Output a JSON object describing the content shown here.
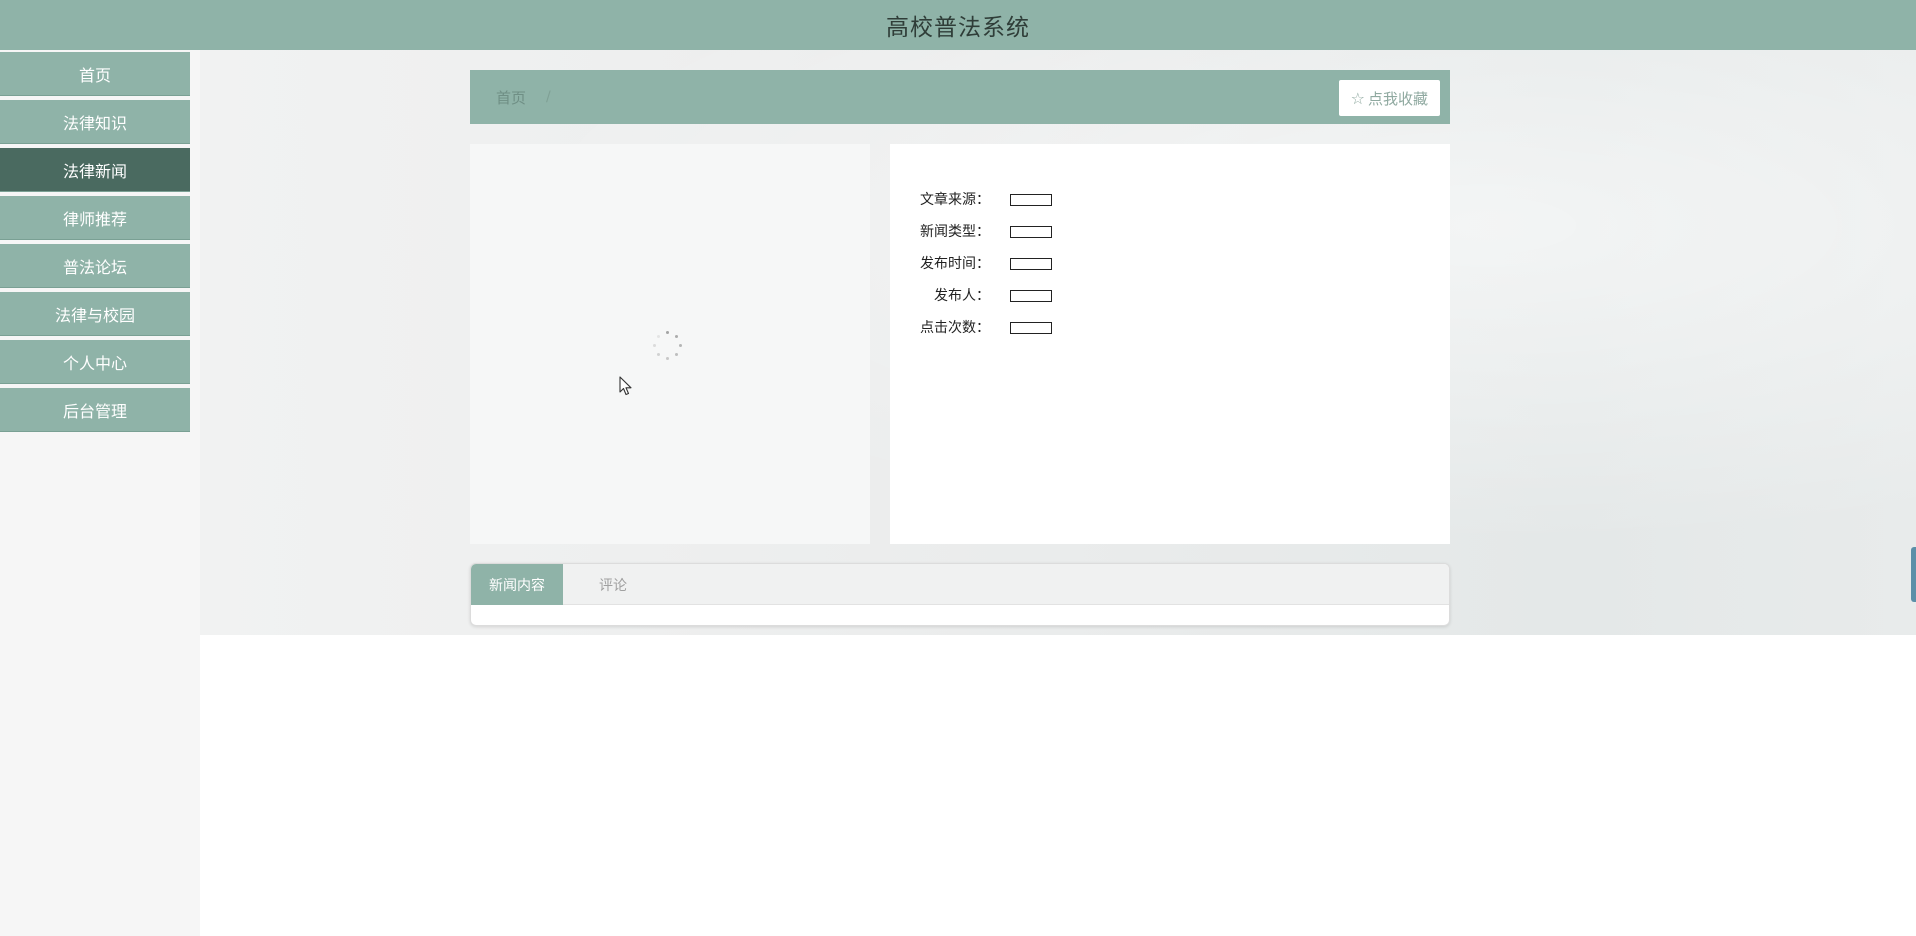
{
  "header": {
    "title": "高校普法系统"
  },
  "sidebar": {
    "items": [
      {
        "label": "首页"
      },
      {
        "label": "法律知识"
      },
      {
        "label": "法律新闻"
      },
      {
        "label": "律师推荐"
      },
      {
        "label": "普法论坛"
      },
      {
        "label": "法律与校园"
      },
      {
        "label": "个人中心"
      },
      {
        "label": "后台管理"
      }
    ],
    "active": "法律新闻"
  },
  "breadcrumb": {
    "home": "首页",
    "separator": "/"
  },
  "favorite": {
    "label": "点我收藏",
    "icon": "star-outline-icon"
  },
  "details": {
    "fields": [
      {
        "label": "文章来源：",
        "value": ""
      },
      {
        "label": "新闻类型：",
        "value": ""
      },
      {
        "label": "发布时间：",
        "value": ""
      },
      {
        "label": "发布人：",
        "value": ""
      },
      {
        "label": "点击次数：",
        "value": ""
      }
    ]
  },
  "tabs": [
    {
      "label": "新闻内容",
      "active": true
    },
    {
      "label": "评论",
      "active": false
    }
  ],
  "colors": {
    "accent": "#8fb3a8",
    "active_nav": "#4a6a60"
  }
}
